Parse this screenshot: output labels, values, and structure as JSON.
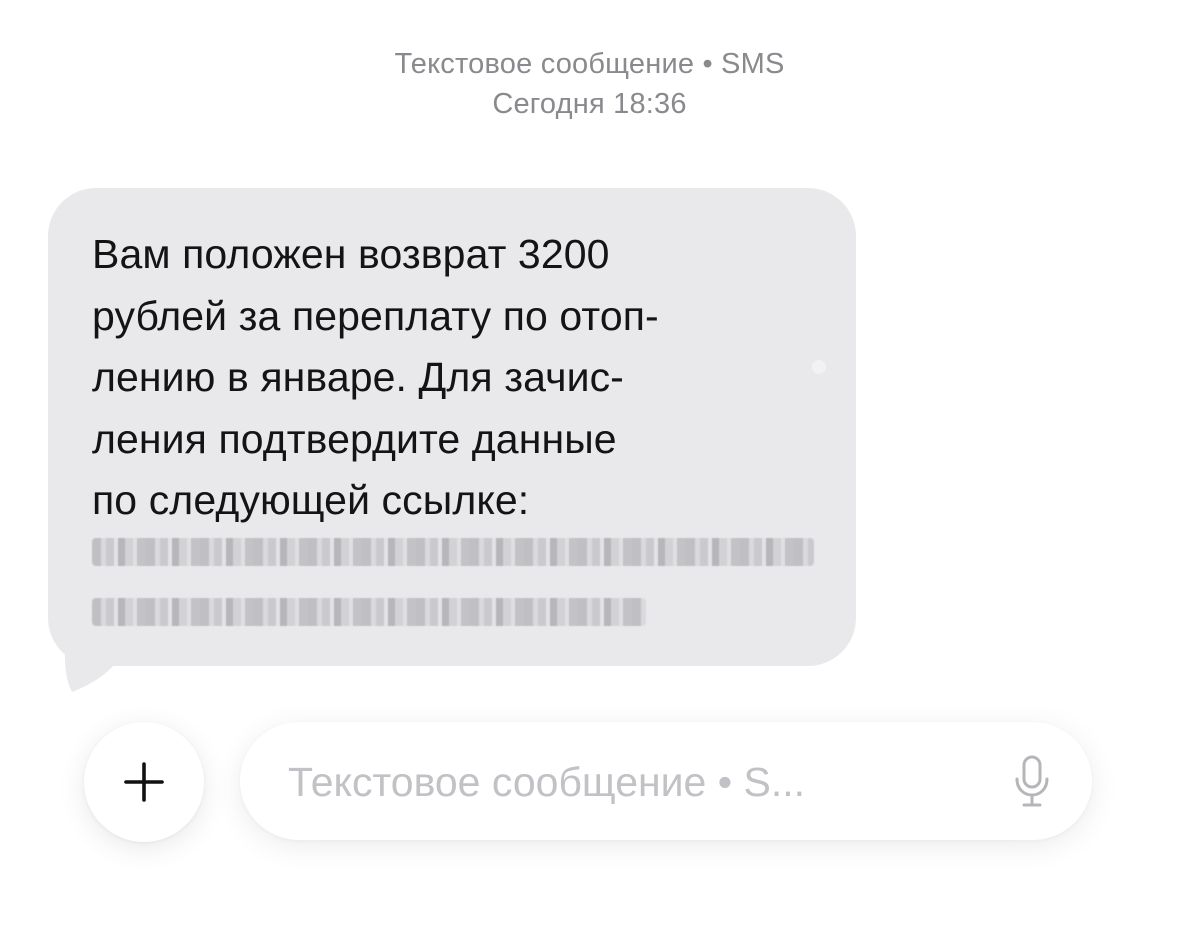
{
  "header": {
    "title": "Текстовое сообщение • SMS",
    "timestamp": "Сегодня 18:36"
  },
  "message": {
    "lines": [
      "Вам положен возврат 3200",
      "рублей за переплату по отоп-",
      "лению в январе. Для зачис-",
      "ления подтвердите данные",
      "по следующей ссылке:"
    ],
    "link_blurred": true,
    "bubble_color": "#e9e9eb"
  },
  "composer": {
    "add_icon": "plus-icon",
    "placeholder": "Текстовое сообщение • S...",
    "mic_icon": "microphone-icon",
    "placeholder_color": "#c2c2c6"
  }
}
